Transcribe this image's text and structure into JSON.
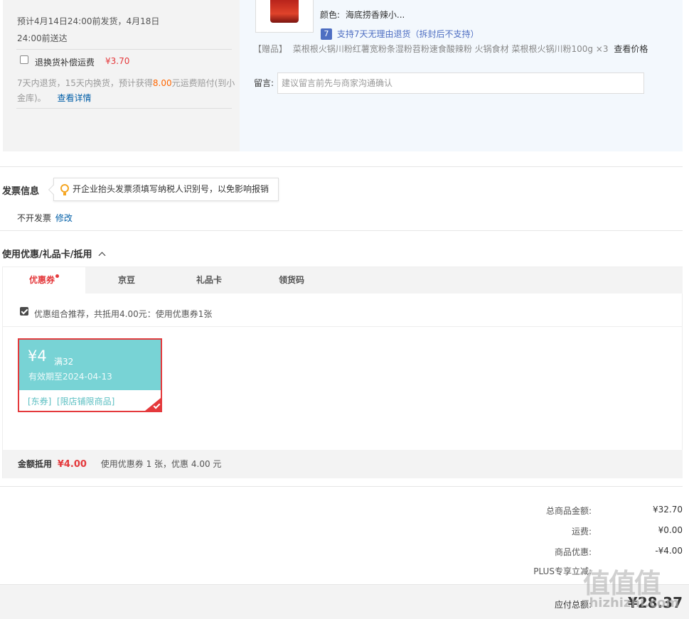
{
  "shipping": {
    "estimate_line1": "预计4月14日24:00前发货，4月18日",
    "estimate_line2": "24:00前送达",
    "return_insurance_label": "退换货补偿运费",
    "return_insurance_price": "¥3.70",
    "policy_part1": "7天内退货，15天内换货，预计获得",
    "policy_amount": "8.00",
    "policy_part2": "元运费赔付(到小",
    "policy_line2": "金库)。",
    "details_link": "查看详情"
  },
  "item": {
    "color_label": "颜色:",
    "color_value": "海底捞香辣小...",
    "return_icon_text": "7",
    "return_policy": "支持7天无理由退货（拆封后不支持）",
    "gift_tag": "【赠品】",
    "gift_desc": "菜根根火锅川粉红薯宽粉条湿粉苕粉速食酸辣粉 火锅食材 菜根根火锅川粉100g ×3",
    "gift_price_link": "查看价格",
    "message_label": "留言:",
    "message_placeholder": "建议留言前先与商家沟通确认"
  },
  "invoice": {
    "title": "发票信息",
    "tip": "开企业抬头发票须填写纳税人识别号，以免影响报销",
    "status": "不开发票",
    "edit_link": "修改"
  },
  "discount": {
    "title": "使用优惠/礼品卡/抵用",
    "tabs": [
      {
        "label": "优惠券"
      },
      {
        "label": "京豆"
      },
      {
        "label": "礼品卡"
      },
      {
        "label": "领货码"
      }
    ],
    "recommend_text": "优惠组合推荐，共抵用4.00元：使用优惠券1张",
    "coupon": {
      "amount": "¥4",
      "condition": "满32",
      "validity": "有效期至2024-04-13",
      "tags": "[东券]  [限店铺限商品]"
    },
    "amount_label": "金额抵用",
    "amount_value": "¥4.00",
    "amount_summary": "使用优惠券 1 张，优惠 4.00 元"
  },
  "totals": {
    "rows": [
      {
        "label": "总商品金额:",
        "value": "¥32.70"
      },
      {
        "label": "运费:",
        "value": "¥0.00"
      },
      {
        "label": "商品优惠:",
        "value": "-¥4.00"
      },
      {
        "label": "PLUS专享立减:",
        "value": ""
      }
    ],
    "payable_label": "应付总额:",
    "payable_value": "¥28.37"
  },
  "watermark": {
    "text": "值值值",
    "sub": "zhizhizhi.com"
  },
  "colors": {
    "accent_red": "#e4393c",
    "link_blue": "#005ea7",
    "coupon_teal": "#78d3d5"
  }
}
